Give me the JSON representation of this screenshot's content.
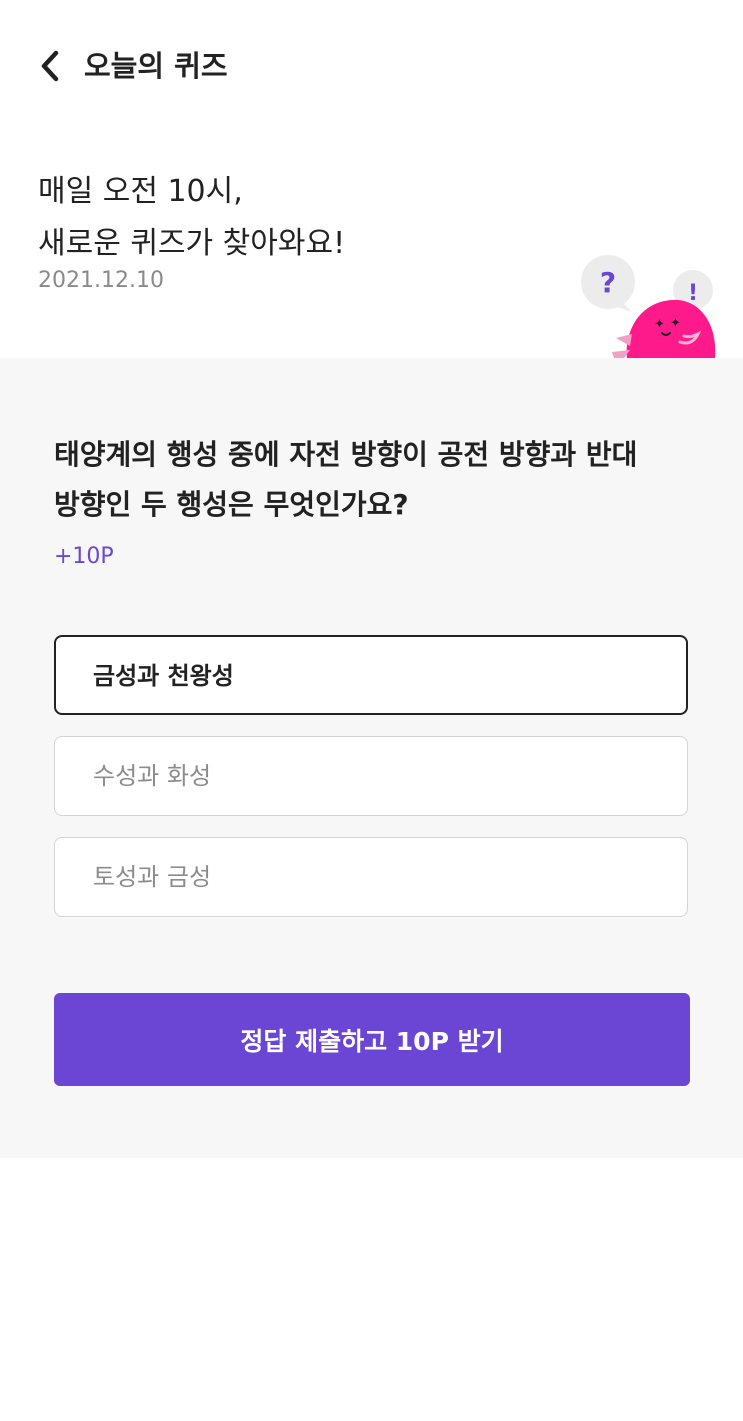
{
  "header": {
    "back_icon": "chevron-left-icon",
    "title": "오늘의 퀴즈"
  },
  "intro": {
    "headline_line1": "매일 오전 10시,",
    "headline_line2": "새로운 퀴즈가 찾아와요!",
    "date": "2021.12.10",
    "question_bubble": "?",
    "exclaim_bubble": "!"
  },
  "quiz": {
    "question_line1": "태양계의 행성 중에 자전 방향이 공전 방향과 반대",
    "question_line2": "방향인 두 행성은 무엇인가요?",
    "points": "+10P",
    "options": [
      {
        "label": "금성과 천왕성",
        "selected": true
      },
      {
        "label": "수성과 화성",
        "selected": false
      },
      {
        "label": "토성과 금성",
        "selected": false
      }
    ],
    "submit_label": "정답 제출하고 10P 받기"
  },
  "colors": {
    "accent": "#6b46d4",
    "panel_bg": "#f7f7f7",
    "mascot": "#ff1a8c"
  }
}
